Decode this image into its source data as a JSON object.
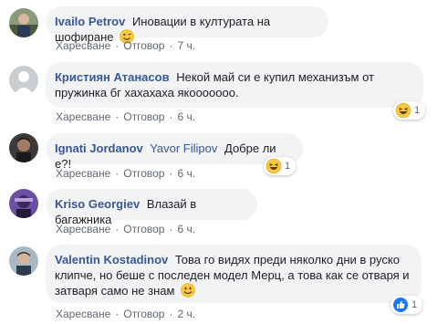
{
  "comments": [
    {
      "author": "Ivailo Petrov",
      "mention": "",
      "text": "Иновации в културата на шофиране",
      "emoji": "wink-emoji",
      "actions": {
        "like": "Харесване",
        "reply": "Отговор",
        "time": "7 ч."
      }
    },
    {
      "author": "Кристиян Атанасов",
      "mention": "",
      "text": "Некой май си е купил механизъм от пружинка бг хахахаха якооооооо.",
      "emoji": "",
      "actions": {
        "like": "Харесване",
        "reply": "Отговор",
        "time": "6 ч."
      },
      "reaction": {
        "icon": "laugh-reaction-icon",
        "count": "1"
      }
    },
    {
      "author": "Ignati Jordanov",
      "mention": "Yavor Filipov",
      "text": "Добре ли е?!",
      "emoji": "",
      "actions": {
        "like": "Харесване",
        "reply": "Отговор",
        "time": "6 ч."
      },
      "reaction": {
        "icon": "laugh-reaction-icon",
        "count": "1"
      }
    },
    {
      "author": "Kriso Georgiev",
      "mention": "",
      "text": "Влазай в багажника",
      "emoji": "",
      "actions": {
        "like": "Харесване",
        "reply": "Отговор",
        "time": "6 ч."
      }
    },
    {
      "author": "Valentin Kostadinov",
      "mention": "",
      "text": "Това го видях преди няколко дни в руско клипче, но беше с последен модел Мерц, а това как се отваря и затваря само не знам",
      "emoji": "smile-emoji",
      "actions": {
        "like": "Харесване",
        "reply": "Отговор",
        "time": "2 ч."
      },
      "reaction": {
        "icon": "like-reaction-icon",
        "count": "1"
      }
    }
  ],
  "colors": {
    "author": "#385898",
    "bubble": "#f2f3f5",
    "meta": "#606770",
    "like_blue": "#1877f2",
    "emoji_yellow": "#f7c843"
  }
}
